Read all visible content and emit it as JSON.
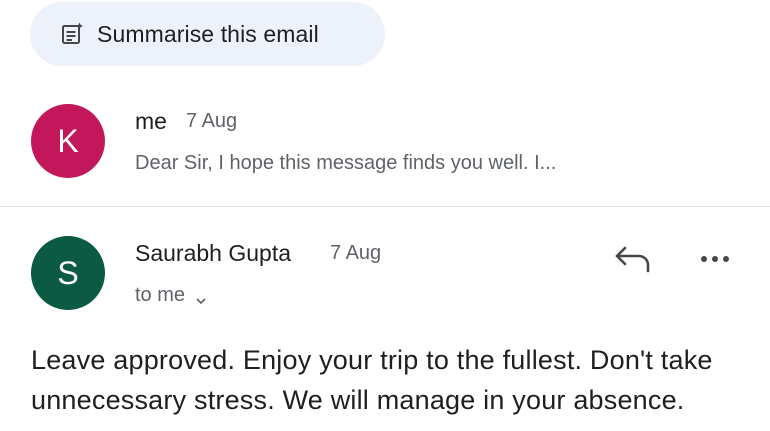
{
  "summarise": {
    "label": "Summarise this email",
    "icon": "summarise-icon"
  },
  "messages": [
    {
      "avatar_letter": "K",
      "avatar_color": "#c2185b",
      "sender": "me",
      "date": "7 Aug",
      "snippet": "Dear Sir, I hope this message finds you well. I..."
    },
    {
      "avatar_letter": "S",
      "avatar_color": "#0b5a43",
      "sender": "Saurabh Gupta",
      "date": "7 Aug",
      "recipient": "to me",
      "body": "Leave approved. Enjoy your trip to the fullest. Don't take unnecessary stress. We will manage in your absence."
    }
  ],
  "actions": {
    "reply_icon": "reply-icon",
    "more_icon": "more-options-icon"
  },
  "colors": {
    "chip_bg": "#edf2fa",
    "secondary_text": "#5f6368",
    "divider": "#e3e3e3"
  }
}
